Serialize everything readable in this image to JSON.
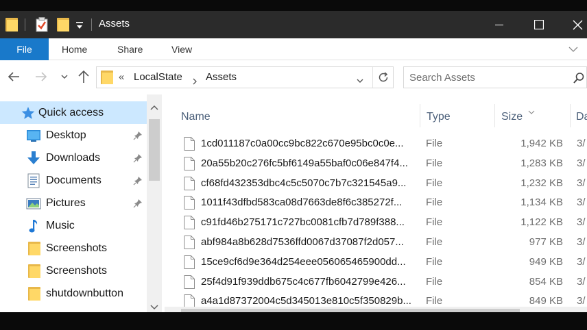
{
  "window": {
    "title": "Assets",
    "icons": [
      "folder-icon",
      "properties-icon",
      "new-folder-icon",
      "customize-toolbar-icon"
    ],
    "controls": [
      "minimize-icon",
      "maximize-icon",
      "close-icon"
    ]
  },
  "ribbon": {
    "tabs": [
      {
        "label": "File",
        "active": true
      },
      {
        "label": "Home"
      },
      {
        "label": "Share"
      },
      {
        "label": "View"
      }
    ]
  },
  "address": {
    "overflow": "«",
    "crumbs": [
      "LocalState",
      "Assets"
    ]
  },
  "search": {
    "placeholder": "Search Assets"
  },
  "nav": {
    "items": [
      {
        "label": "Quick access",
        "icon": "star-icon",
        "selected": true,
        "pinned": false
      },
      {
        "label": "Desktop",
        "icon": "desktop-icon",
        "pinned": true
      },
      {
        "label": "Downloads",
        "icon": "download-arrow-icon",
        "pinned": true
      },
      {
        "label": "Documents",
        "icon": "document-icon",
        "pinned": true
      },
      {
        "label": "Pictures",
        "icon": "pictures-icon",
        "pinned": true
      },
      {
        "label": "Music",
        "icon": "music-note-icon",
        "pinned": false
      },
      {
        "label": "Screenshots",
        "icon": "folder-icon",
        "pinned": false
      },
      {
        "label": "Screenshots",
        "icon": "folder-icon",
        "pinned": false
      },
      {
        "label": "shutdownbutton",
        "icon": "folder-icon",
        "pinned": false
      }
    ]
  },
  "list": {
    "columns": {
      "name": "Name",
      "type": "Type",
      "size": "Size",
      "date": "Da"
    },
    "rows": [
      {
        "name": "1cd011187c0a00cc9bc822c670e95bc0c0e...",
        "type": "File",
        "size": "1,942 KB",
        "date": "3/"
      },
      {
        "name": "20a55b20c276fc5bf6149a55baf0c06e847f4...",
        "type": "File",
        "size": "1,283 KB",
        "date": "3/"
      },
      {
        "name": "cf68fd432353dbc4c5c5070c7b7c321545a9...",
        "type": "File",
        "size": "1,232 KB",
        "date": "3/"
      },
      {
        "name": "1011f43dfbd583ca08d7663de8f6c385272f...",
        "type": "File",
        "size": "1,134 KB",
        "date": "3/"
      },
      {
        "name": "c91fd46b275171c727bc0081cfb7d789f388...",
        "type": "File",
        "size": "1,122 KB",
        "date": "3/"
      },
      {
        "name": "abf984a8b628d7536ffd0067d37087f2d057...",
        "type": "File",
        "size": "977 KB",
        "date": "3/"
      },
      {
        "name": "15ce9cf6d9e364d254eee056065465900dd...",
        "type": "File",
        "size": "949 KB",
        "date": "3/"
      },
      {
        "name": "25f4d91f939ddb675c4c677fb6042799e426...",
        "type": "File",
        "size": "854 KB",
        "date": "3/"
      },
      {
        "name": "a4a1d87372004c5d345013e810c5f350829b...",
        "type": "File",
        "size": "849 KB",
        "date": "3/"
      }
    ]
  }
}
